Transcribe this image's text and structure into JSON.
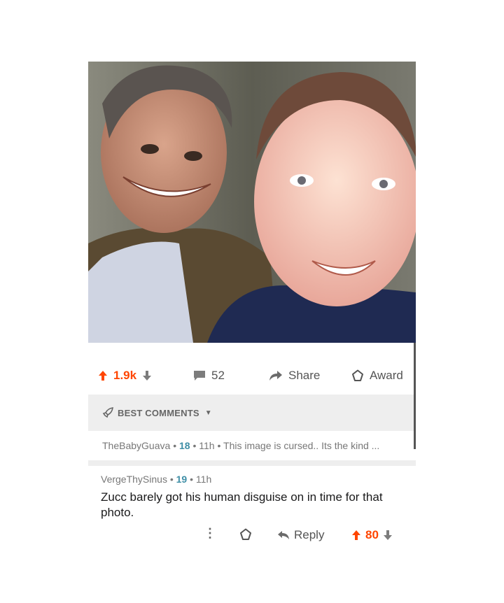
{
  "post": {
    "upvotes": "1.9k",
    "comment_count": "52",
    "share_label": "Share",
    "award_label": "Award"
  },
  "sort": {
    "label": "BEST COMMENTS"
  },
  "collapsed_comment": {
    "author": "TheBabyGuava",
    "score": "18",
    "age": "11h",
    "preview": "This image is cursed.. Its the kind ..."
  },
  "comment": {
    "author": "VergeThySinus",
    "score": "19",
    "age": "11h",
    "text": "Zucc barely got his human disguise on in time for that photo.",
    "reply_label": "Reply",
    "votes": "80"
  },
  "colors": {
    "upvote": "#ff4500",
    "score": "#3e8ea6",
    "muted": "#777777",
    "sort_bg": "#eeeeee"
  },
  "icons": [
    "upvote-arrow-icon",
    "downvote-arrow-icon",
    "comment-bubble-icon",
    "share-arrow-icon",
    "award-icon",
    "rocket-icon",
    "caret-down-icon",
    "more-vertical-icon",
    "reply-arrow-icon"
  ]
}
